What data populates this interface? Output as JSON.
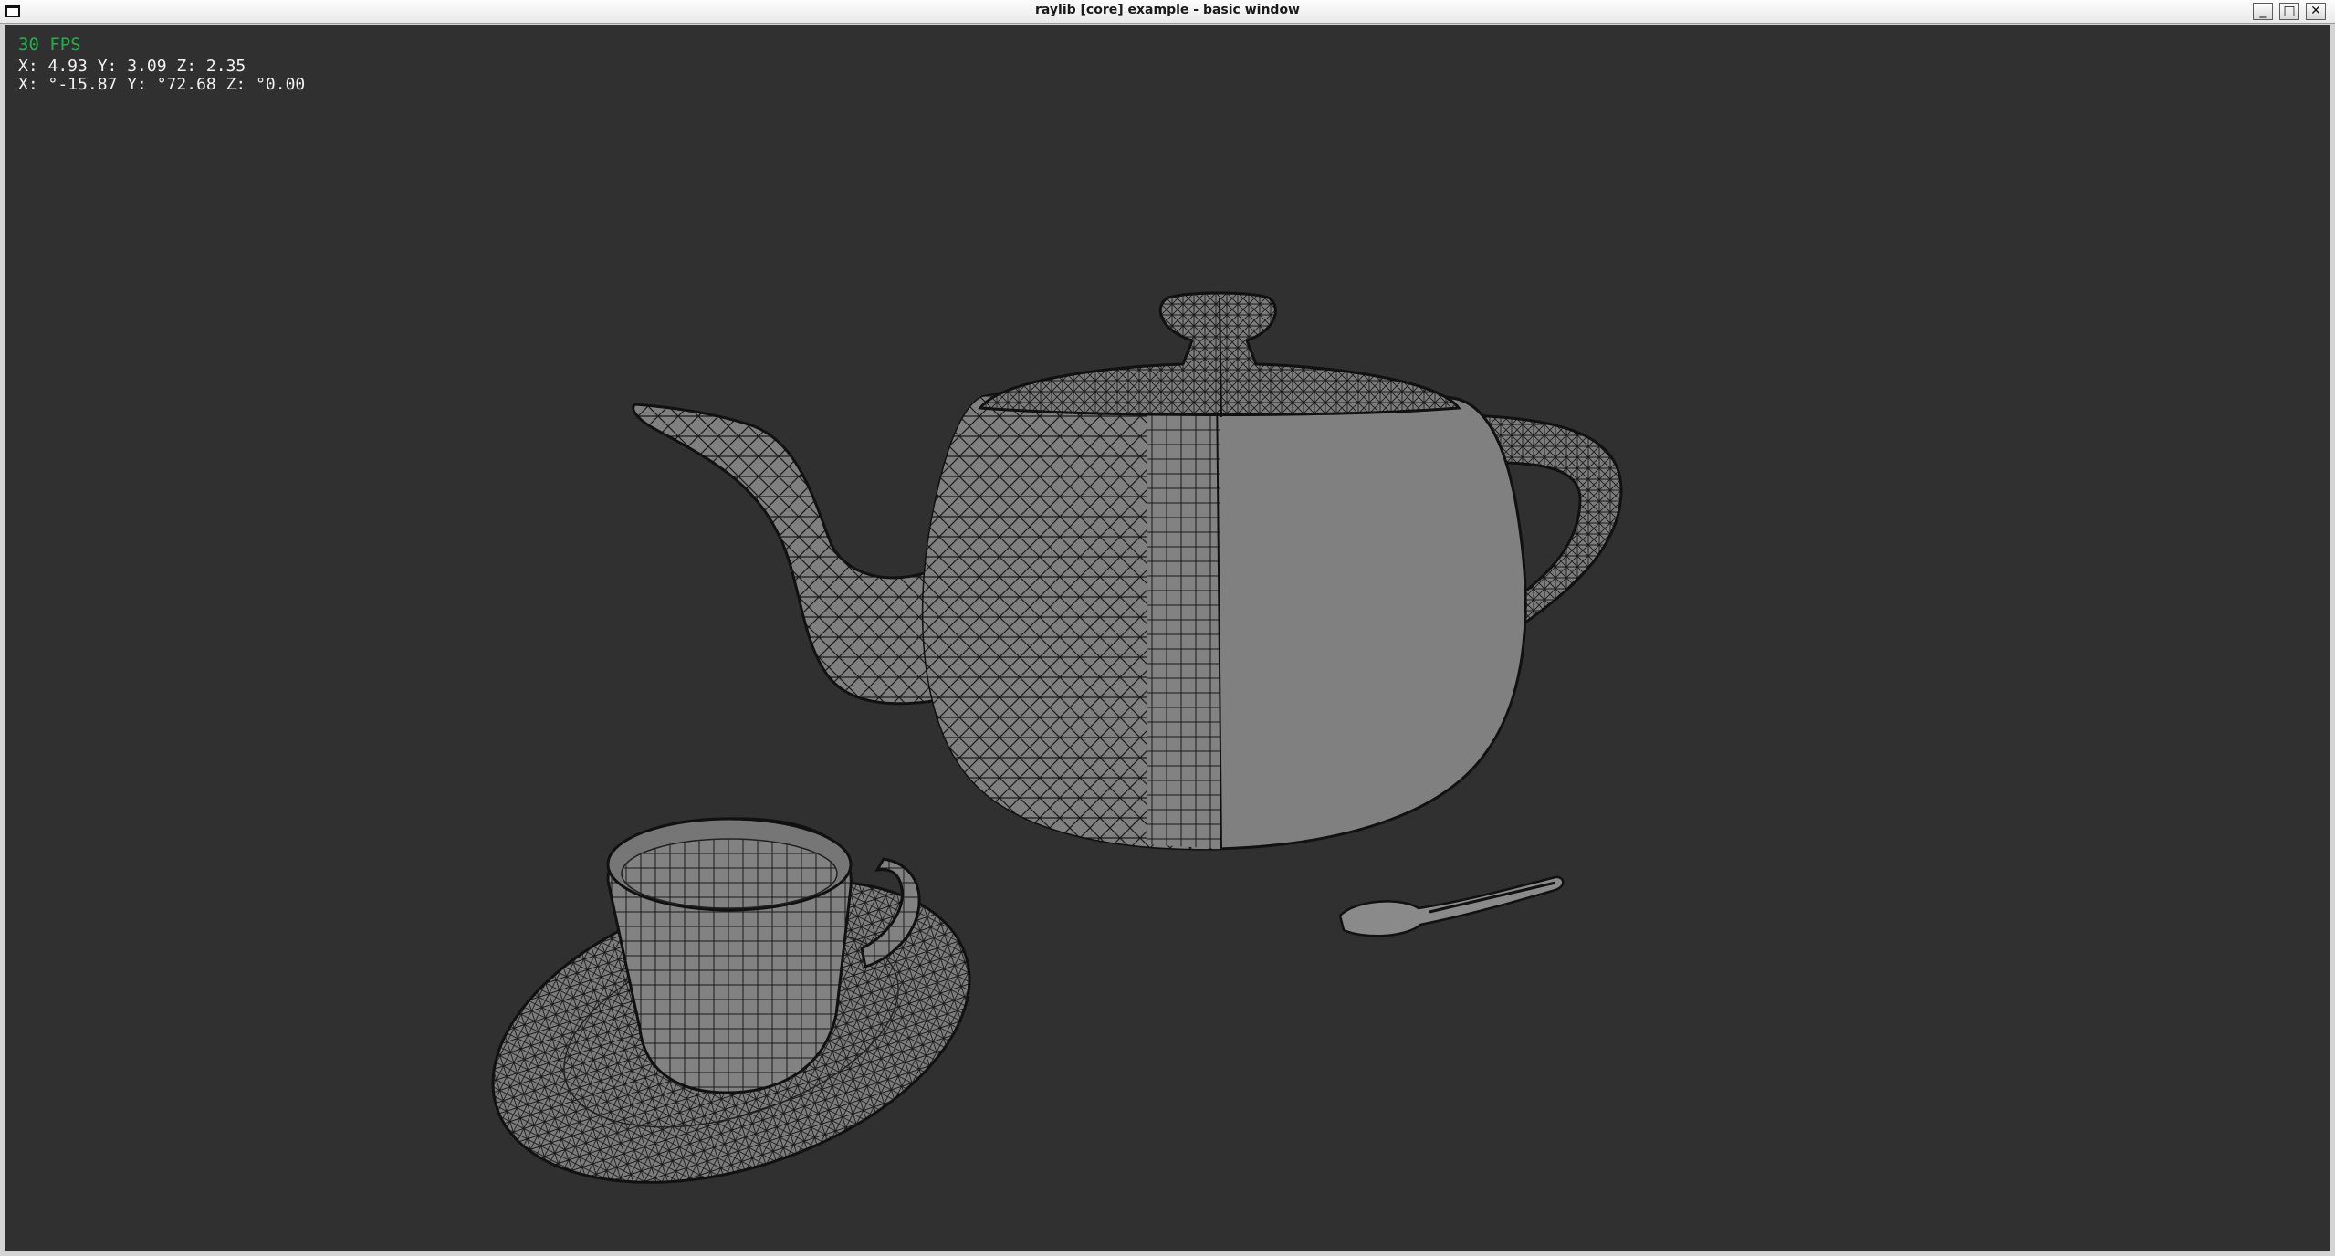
{
  "window": {
    "title": "raylib [core] example - basic window",
    "buttons": {
      "minimize": "_",
      "maximize": "□",
      "close": "✕"
    }
  },
  "hud": {
    "fps": "30 FPS",
    "position": "X: 4.93 Y: 3.09 Z: 2.35",
    "rotation": "X: °-15.87 Y: °72.68 Z: °0.00"
  },
  "colors": {
    "background": "#303030",
    "model_fill": "#808080",
    "wire": "#111111",
    "fps_text": "#22b14c",
    "hud_text": "#f2f2f2"
  },
  "scene": {
    "objects": [
      "teapot",
      "teacup",
      "saucer",
      "spoon"
    ],
    "render_mode": "wireframe-over-solid"
  }
}
